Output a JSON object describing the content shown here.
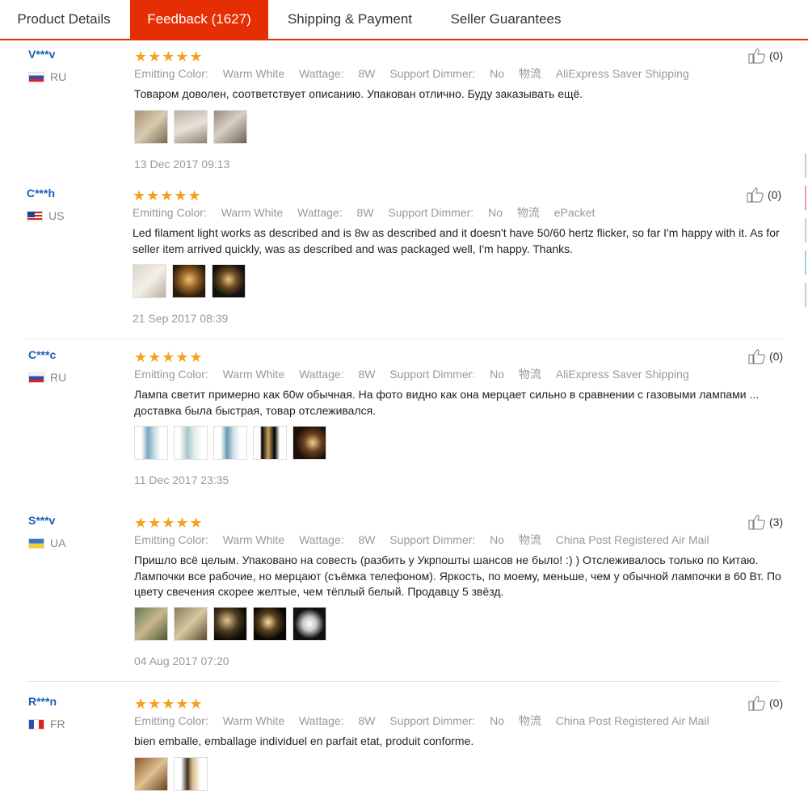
{
  "tabs": [
    {
      "label": "Product Details"
    },
    {
      "label": "Feedback (1627)"
    },
    {
      "label": "Shipping & Payment"
    },
    {
      "label": "Seller Guarantees"
    }
  ],
  "colors": {
    "accent": "#e62e04",
    "star": "#f7a01d",
    "username": "#1a5eb8"
  },
  "reviews": [
    {
      "user": "V***v",
      "country": "RU",
      "stars": "★★★★★",
      "color_label": "Emitting Color:",
      "color_value": "Warm White",
      "wattage_label": "Wattage:",
      "wattage_value": "8W",
      "dimmer_label": "Support Dimmer:",
      "dimmer_value": "No",
      "shipping_label": "物流",
      "shipping_value": "AliExpress Saver Shipping",
      "text": "Товаром доволен, соответствует описанию. Упакован отлично. Буду заказывать ещё.",
      "photo_count": 3,
      "date": "13 Dec 2017 09:13",
      "helpful": "(0)"
    },
    {
      "user": "C***h",
      "country": "US",
      "stars": "★★★★★",
      "color_label": "Emitting Color:",
      "color_value": "Warm White",
      "wattage_label": "Wattage:",
      "wattage_value": "8W",
      "dimmer_label": "Support Dimmer:",
      "dimmer_value": "No",
      "shipping_label": "物流",
      "shipping_value": "ePacket",
      "text": "Led filament light works as described and is 8w as described and it doesn't have 50/60 hertz flicker, so far I'm happy with it. As for seller item arrived quickly, was as described and was packaged well, I'm happy. Thanks.",
      "photo_count": 3,
      "date": "21 Sep 2017 08:39",
      "helpful": "(0)"
    },
    {
      "user": "C***c",
      "country": "RU",
      "stars": "★★★★★",
      "color_label": "Emitting Color:",
      "color_value": "Warm White",
      "wattage_label": "Wattage:",
      "wattage_value": "8W",
      "dimmer_label": "Support Dimmer:",
      "dimmer_value": "No",
      "shipping_label": "物流",
      "shipping_value": "AliExpress Saver Shipping",
      "text": "Лампа светит примерно как 60w обычная. На фото видно как она мерцает сильно в сравнении с газовыми лампами ... доставка была быстрая, товар отслеживался.",
      "photo_count": 5,
      "date": "11 Dec 2017 23:35",
      "helpful": "(0)"
    },
    {
      "user": "S***v",
      "country": "UA",
      "stars": "★★★★★",
      "color_label": "Emitting Color:",
      "color_value": "Warm White",
      "wattage_label": "Wattage:",
      "wattage_value": "8W",
      "dimmer_label": "Support Dimmer:",
      "dimmer_value": "No",
      "shipping_label": "物流",
      "shipping_value": "China Post Registered Air Mail",
      "text": "Пришло всё целым. Упаковано на совесть (разбить у Укрпошты шансов не было! :) ) Отслеживалось только по Китаю. Лампочки все рабочие, но мерцают (съёмка телефоном). Яркость, по моему, меньше, чем у обычной лампочки в 60 Вт. По цвету свечения скорее желтые, чем тёплый белый. Продавцу 5 звёзд.",
      "photo_count": 5,
      "date": "04 Aug 2017 07:20",
      "helpful": "(3)"
    },
    {
      "user": "R***n",
      "country": "FR",
      "stars": "★★★★★",
      "color_label": "Emitting Color:",
      "color_value": "Warm White",
      "wattage_label": "Wattage:",
      "wattage_value": "8W",
      "dimmer_label": "Support Dimmer:",
      "dimmer_value": "No",
      "shipping_label": "物流",
      "shipping_value": "China Post Registered Air Mail",
      "text": "bien emballe, emballage individuel en parfait etat, produit conforme.",
      "photo_count": 2,
      "date": "",
      "helpful": "(0)"
    }
  ]
}
